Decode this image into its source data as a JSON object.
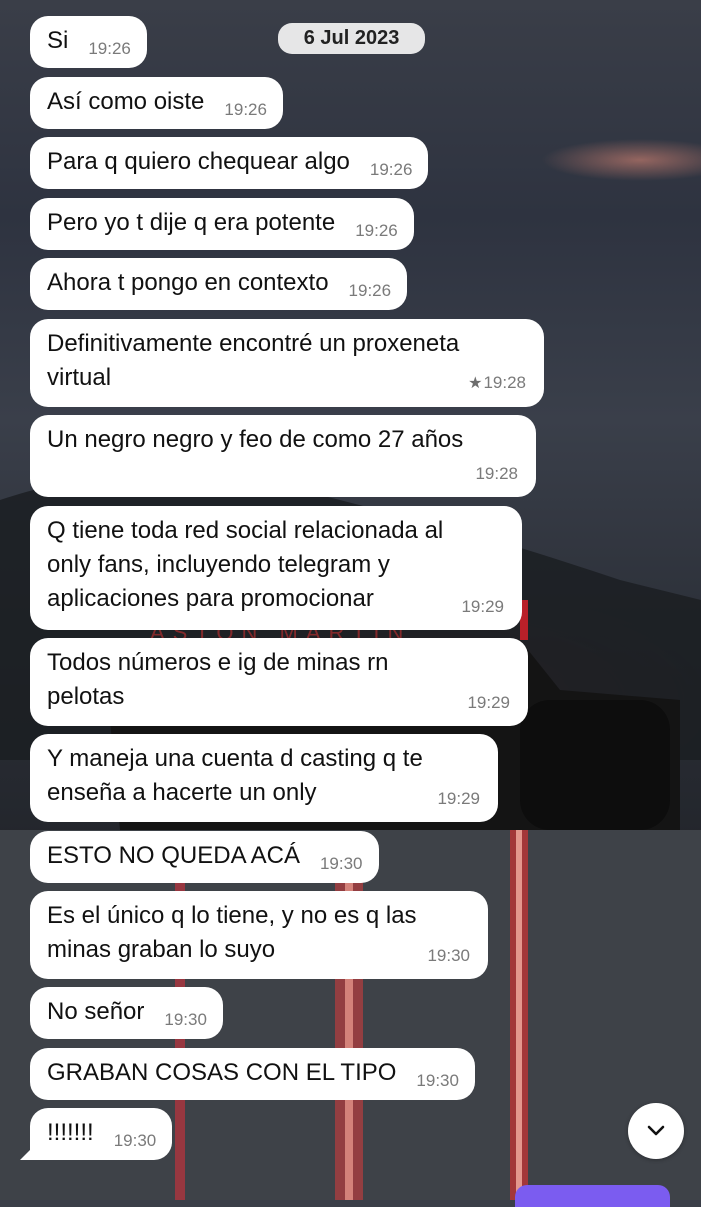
{
  "conversation": {
    "date_chip": "6 Jul 2023",
    "messages": [
      {
        "text": "Si",
        "time": "19:26"
      },
      {
        "text": "Así como oiste",
        "time": "19:26"
      },
      {
        "text": "Para q quiero chequear algo",
        "time": "19:26"
      },
      {
        "text": "Pero yo t dije q era potente",
        "time": "19:26"
      },
      {
        "text": "Ahora t pongo en contexto",
        "time": "19:26"
      },
      {
        "lines": [
          "Definitivamente encontré un proxeneta",
          "virtual"
        ],
        "time": "19:28",
        "starred": true,
        "star_glyph": "★"
      },
      {
        "lines": [
          "Un negro negro y feo de como 27 años"
        ],
        "time": "19:28"
      },
      {
        "lines": [
          "Q tiene toda red social relacionada al",
          "only fans, incluyendo telegram y",
          "aplicaciones para promocionar"
        ],
        "time": "19:29"
      },
      {
        "lines": [
          "Todos números e ig de minas rn",
          "pelotas"
        ],
        "time": "19:29"
      },
      {
        "lines": [
          "Y maneja una cuenta d casting q te",
          "enseña a hacerte un only"
        ],
        "time": "19:29"
      },
      {
        "text": "ESTO NO QUEDA ACÁ",
        "time": "19:30"
      },
      {
        "lines": [
          "Es el único q lo tiene, y no es q las",
          "minas graban lo suyo"
        ],
        "time": "19:30"
      },
      {
        "text": "No señor",
        "time": "19:30"
      },
      {
        "text": "GRABAN COSAS CON EL TIPO",
        "time": "19:30"
      },
      {
        "text": "!!!!!!!",
        "time": "19:30"
      }
    ]
  },
  "controls": {
    "scroll_down_icon": "chevron-down-icon",
    "accent_color": "#7b5cf0"
  },
  "background": {
    "wallpaper_text": "ASTON MARTIN"
  }
}
